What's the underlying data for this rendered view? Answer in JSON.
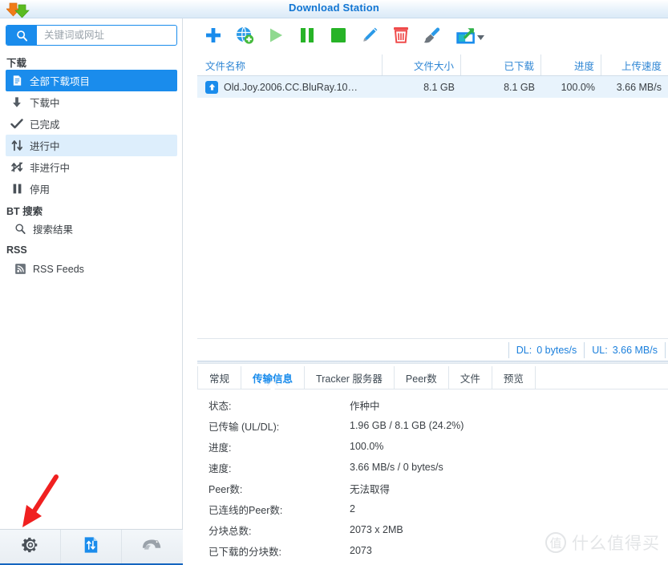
{
  "window": {
    "title": "Download Station",
    "logo_icon": "download-arrows-logo",
    "accent_color": "#1a8cec",
    "title_color": "#1175d2"
  },
  "search": {
    "placeholder": "关键词或网址",
    "value": "",
    "icon": "search-icon"
  },
  "sidebar": {
    "groups": [
      {
        "title": "下载",
        "items": [
          {
            "label": "全部下载项目",
            "icon": "document-list-icon",
            "state": "selected"
          },
          {
            "label": "下载中",
            "icon": "arrow-down-icon",
            "state": "normal"
          },
          {
            "label": "已完成",
            "icon": "check-icon",
            "state": "normal"
          },
          {
            "label": "进行中",
            "icon": "up-down-arrows-icon",
            "state": "hover"
          },
          {
            "label": "非进行中",
            "icon": "crossed-arrows-icon",
            "state": "normal"
          },
          {
            "label": "停用",
            "icon": "pause-icon",
            "state": "normal"
          }
        ]
      },
      {
        "title": "BT 搜索",
        "items": [
          {
            "label": "搜索结果",
            "icon": "search-icon",
            "state": "normal"
          }
        ]
      },
      {
        "title": "RSS",
        "items": [
          {
            "label": "RSS Feeds",
            "icon": "rss-icon",
            "state": "normal"
          }
        ]
      }
    ],
    "bottom_toolbar": [
      {
        "icon": "gear-icon",
        "name": "settings"
      },
      {
        "icon": "transfer-schedule-icon",
        "name": "transfer-schedule"
      },
      {
        "icon": "emule-icon",
        "name": "emule-settings"
      }
    ]
  },
  "toolbar": {
    "buttons": [
      {
        "icon": "plus-icon",
        "name": "add-task",
        "color": "#1a8cec"
      },
      {
        "icon": "globe-add-icon",
        "name": "add-url",
        "color": "#1a8cec"
      },
      {
        "icon": "play-icon",
        "name": "resume",
        "color": "#8fd98f"
      },
      {
        "icon": "pause-icon",
        "name": "pause",
        "color": "#27b327"
      },
      {
        "icon": "stop-icon",
        "name": "stop",
        "color": "#27b327"
      },
      {
        "icon": "pencil-icon",
        "name": "edit",
        "color": "#1a8cec"
      },
      {
        "icon": "trash-icon",
        "name": "delete",
        "color": "#ef4b4b"
      },
      {
        "icon": "broom-icon",
        "name": "clear-completed",
        "color": "#8a9097"
      },
      {
        "icon": "share-icon",
        "name": "share",
        "color": "#1a8cec",
        "has_dropdown": true
      }
    ]
  },
  "table": {
    "columns": [
      {
        "label": "文件名称",
        "align": "left"
      },
      {
        "label": "文件大小",
        "align": "right"
      },
      {
        "label": "已下载",
        "align": "right"
      },
      {
        "label": "进度",
        "align": "right"
      },
      {
        "label": "上传速度",
        "align": "right"
      }
    ],
    "rows": [
      {
        "status_icon": "seeding-up-arrow-icon",
        "filename": "Old.Joy.2006.CC.BluRay.10…",
        "filesize": "8.1 GB",
        "downloaded": "8.1 GB",
        "progress": "100.0%",
        "upload_speed": "3.66 MB/s",
        "selected": true
      }
    ]
  },
  "status_strip": {
    "download_label": "DL:",
    "download_value": "0 bytes/s",
    "upload_label": "UL:",
    "upload_value": "3.66 MB/s"
  },
  "detail_tabs": [
    {
      "label": "常规",
      "active": false
    },
    {
      "label": "传输信息",
      "active": true
    },
    {
      "label": "Tracker 服务器",
      "active": false
    },
    {
      "label": "Peer数",
      "active": false
    },
    {
      "label": "文件",
      "active": false
    },
    {
      "label": "预览",
      "active": false
    }
  ],
  "details": [
    {
      "label": "状态:",
      "value": "作种中"
    },
    {
      "label": "已传输 (UL/DL):",
      "value": "1.96 GB / 8.1 GB (24.2%)"
    },
    {
      "label": "进度:",
      "value": "100.0%"
    },
    {
      "label": "速度:",
      "value": "3.66 MB/s / 0 bytes/s"
    },
    {
      "label": "Peer数:",
      "value": "无法取得"
    },
    {
      "label": "已连线的Peer数:",
      "value": "2"
    },
    {
      "label": "分块总数:",
      "value": "2073 x 2MB"
    },
    {
      "label": "已下载的分块数:",
      "value": "2073"
    }
  ],
  "watermark": {
    "badge": "值",
    "text": "什么值得买"
  },
  "annotation": {
    "type": "arrow",
    "color": "#f02020",
    "points_to": "settings-gear-button"
  }
}
